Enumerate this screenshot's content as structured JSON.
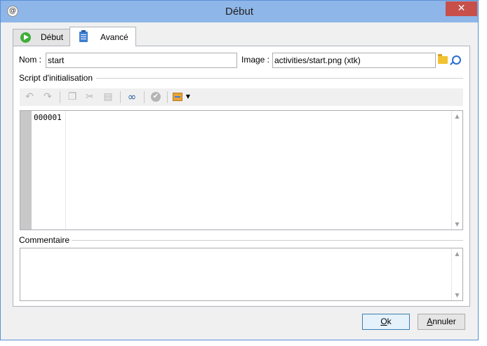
{
  "window": {
    "title": "Début",
    "close_glyph": "✕",
    "app_icon": "@"
  },
  "tabs": [
    {
      "label": "Début",
      "icon": "play-icon"
    },
    {
      "label": "Avancé",
      "icon": "clipboard-icon"
    }
  ],
  "form": {
    "name_label": "Nom :",
    "name_value": "start",
    "image_label": "Image :",
    "image_value": "activities/start.png (xtk)"
  },
  "script_section": {
    "title": "Script d'initialisation",
    "line_number": "000001"
  },
  "toolbar": {
    "icons": [
      "undo-icon",
      "redo-icon",
      "copy-icon",
      "cut-icon",
      "paste-icon",
      "find-icon",
      "check-icon",
      "insert-icon"
    ]
  },
  "comment_section": {
    "title": "Commentaire"
  },
  "buttons": {
    "ok_hotkey": "O",
    "ok_rest": "k",
    "cancel_hotkey": "A",
    "cancel_rest": "nnuler"
  },
  "colors": {
    "titlebar": "#8fb6e8",
    "close": "#c7504a",
    "accent": "#3f7fd1",
    "play": "#3fae3a"
  }
}
